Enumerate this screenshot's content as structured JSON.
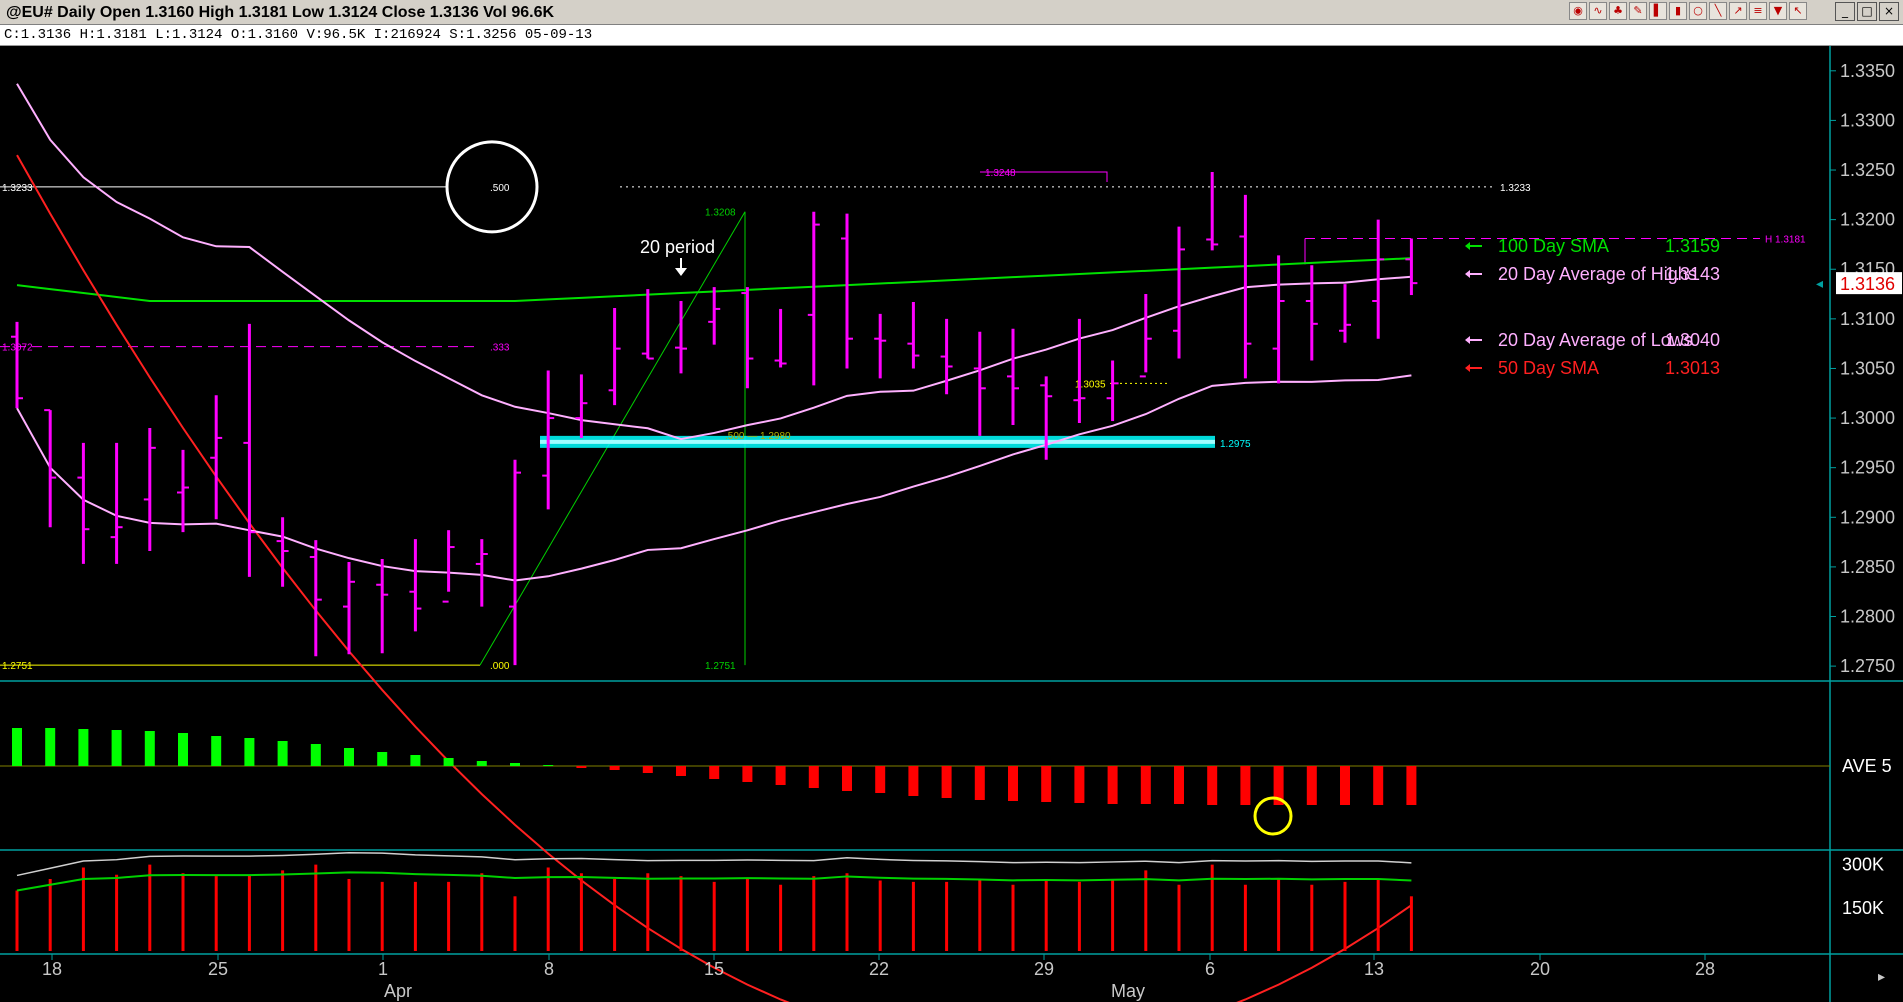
{
  "window": {
    "title": "@EU# Daily Open 1.3160 High 1.3181 Low 1.3124 Close 1.3136 Vol 96.6K",
    "info": "C:1.3136  H:1.3181  L:1.3124  O:1.3160  V:96.5K  I:216924  S:1.3256  05-09-13"
  },
  "toolbar_icons": [
    "globe-icon",
    "wave-icon",
    "tree-icon",
    "pencil-icon",
    "bars-icon",
    "candle-icon",
    "circle-icon",
    "line-icon",
    "arrow-icon",
    "fib-icon",
    "trash-icon",
    "cursor-icon"
  ],
  "window_controls": [
    "minimize-icon",
    "restore-icon",
    "close-icon"
  ],
  "colors": {
    "background": "#000000",
    "bars": "#ff00ff",
    "sma100": "#00e000",
    "sma50": "#ff2020",
    "avg_highs_lows": "#ffb0ff",
    "fib_channel": "#00ffff",
    "osc_positive": "#00ff00",
    "osc_negative": "#ff0000",
    "panel_border": "#00a0a0"
  },
  "chart_data": [
    {
      "type": "ohlc",
      "panel": "price",
      "y_axis": {
        "range": [
          1.2735,
          1.3375
        ],
        "ticks": [
          "1.3350",
          "1.3300",
          "1.3250",
          "1.3200",
          "1.3150",
          "1.3100",
          "1.3050",
          "1.3000",
          "1.2950",
          "1.2900",
          "1.2850",
          "1.2800",
          "1.2750"
        ]
      },
      "last_price_label": "1.3136",
      "bars": [
        {
          "o": 1.3082,
          "h": 1.3097,
          "l": 1.301,
          "c": 1.302
        },
        {
          "o": 1.3008,
          "h": 1.3008,
          "l": 1.289,
          "c": 1.294
        },
        {
          "o": 1.294,
          "h": 1.2975,
          "l": 1.2853,
          "c": 1.2888
        },
        {
          "o": 1.288,
          "h": 1.2975,
          "l": 1.2853,
          "c": 1.289
        },
        {
          "o": 1.2918,
          "h": 1.299,
          "l": 1.2866,
          "c": 1.297
        },
        {
          "o": 1.2925,
          "h": 1.2968,
          "l": 1.2885,
          "c": 1.293
        },
        {
          "o": 1.296,
          "h": 1.3023,
          "l": 1.2898,
          "c": 1.298
        },
        {
          "o": 1.2975,
          "h": 1.3095,
          "l": 1.284,
          "c": 1.2885
        },
        {
          "o": 1.2876,
          "h": 1.29,
          "l": 1.283,
          "c": 1.2866
        },
        {
          "o": 1.286,
          "h": 1.2877,
          "l": 1.276,
          "c": 1.2817
        },
        {
          "o": 1.281,
          "h": 1.2855,
          "l": 1.2762,
          "c": 1.2835
        },
        {
          "o": 1.2832,
          "h": 1.2858,
          "l": 1.2763,
          "c": 1.2822
        },
        {
          "o": 1.2825,
          "h": 1.2878,
          "l": 1.2785,
          "c": 1.2808
        },
        {
          "o": 1.2815,
          "h": 1.2887,
          "l": 1.2825,
          "c": 1.287
        },
        {
          "o": 1.2853,
          "h": 1.2878,
          "l": 1.281,
          "c": 1.2863
        },
        {
          "o": 1.281,
          "h": 1.2958,
          "l": 1.2751,
          "c": 1.2945
        },
        {
          "o": 1.2942,
          "h": 1.3048,
          "l": 1.2908,
          "c": 1.3
        },
        {
          "o": 1.3,
          "h": 1.3044,
          "l": 1.298,
          "c": 1.3015
        },
        {
          "o": 1.3028,
          "h": 1.3111,
          "l": 1.3013,
          "c": 1.307
        },
        {
          "o": 1.3065,
          "h": 1.313,
          "l": 1.306,
          "c": 1.306
        },
        {
          "o": 1.3071,
          "h": 1.3118,
          "l": 1.3045,
          "c": 1.307
        },
        {
          "o": 1.3097,
          "h": 1.3132,
          "l": 1.3074,
          "c": 1.311
        },
        {
          "o": 1.3126,
          "h": 1.3132,
          "l": 1.303,
          "c": 1.306
        },
        {
          "o": 1.3058,
          "h": 1.311,
          "l": 1.3051,
          "c": 1.3055
        },
        {
          "o": 1.3104,
          "h": 1.3208,
          "l": 1.3033,
          "c": 1.3195
        },
        {
          "o": 1.3181,
          "h": 1.3206,
          "l": 1.305,
          "c": 1.308
        },
        {
          "o": 1.308,
          "h": 1.3105,
          "l": 1.304,
          "c": 1.3078
        },
        {
          "o": 1.3075,
          "h": 1.3117,
          "l": 1.305,
          "c": 1.3063
        },
        {
          "o": 1.3062,
          "h": 1.31,
          "l": 1.3024,
          "c": 1.3052
        },
        {
          "o": 1.305,
          "h": 1.3087,
          "l": 1.2982,
          "c": 1.303
        },
        {
          "o": 1.3042,
          "h": 1.309,
          "l": 1.2993,
          "c": 1.303
        },
        {
          "o": 1.3033,
          "h": 1.3042,
          "l": 1.2958,
          "c": 1.3022
        },
        {
          "o": 1.3018,
          "h": 1.31,
          "l": 1.2995,
          "c": 1.302
        },
        {
          "o": 1.302,
          "h": 1.3058,
          "l": 1.2997,
          "c": 1.3035
        },
        {
          "o": 1.3042,
          "h": 1.3125,
          "l": 1.3046,
          "c": 1.308
        },
        {
          "o": 1.3088,
          "h": 1.3193,
          "l": 1.306,
          "c": 1.317
        },
        {
          "o": 1.318,
          "h": 1.3248,
          "l": 1.3169,
          "c": 1.3175
        },
        {
          "o": 1.3183,
          "h": 1.3225,
          "l": 1.304,
          "c": 1.3075
        },
        {
          "o": 1.307,
          "h": 1.3164,
          "l": 1.3035,
          "c": 1.3118
        },
        {
          "o": 1.3118,
          "h": 1.3154,
          "l": 1.3058,
          "c": 1.3095
        },
        {
          "o": 1.3088,
          "h": 1.3135,
          "l": 1.3076,
          "c": 1.3094
        },
        {
          "o": 1.3118,
          "h": 1.32,
          "l": 1.308,
          "c": 1.316
        },
        {
          "o": 1.316,
          "h": 1.3181,
          "l": 1.3124,
          "c": 1.3136
        }
      ],
      "moving_averages": [
        {
          "name": "100 Day SMA",
          "value": "1.3159",
          "color": "#00e000"
        },
        {
          "name": "20 Day Average of Highs",
          "value": "1.3143",
          "color": "#ffb0ff"
        },
        {
          "name": "20 Day Average of Lows",
          "value": "1.3040",
          "color": "#ffb0ff"
        },
        {
          "name": "50 Day SMA",
          "value": "1.3013",
          "color": "#ff2020"
        }
      ],
      "fib_annotations": {
        "left_low": "1.2751",
        "left_low_ratio": ".000",
        "left_high": "1.3233",
        "left_high_ratio": ".500",
        "left_mid": "1.3072",
        "left_mid_ratio": ".333",
        "right_high_line": "1.3233",
        "swing_high": "1.3208",
        "swing_low": "1.2751",
        "mid_ratio": ".500",
        "mid_value": "1.2980",
        "channel_right": "1.2975",
        "peak": "1.3248",
        "low_marker": "1.3035",
        "high_marker": "H 1.3181"
      },
      "annotation_text": "20 period",
      "x_axis": {
        "tick_labels": [
          "18",
          "25",
          "1",
          "8",
          "15",
          "22",
          "29",
          "6",
          "13",
          "20",
          "28"
        ],
        "month_labels": [
          "Apr",
          "May"
        ]
      }
    },
    {
      "type": "bar",
      "panel": "oscillator",
      "label": "AVE 5",
      "values": [
        38,
        38,
        37,
        36,
        35,
        33,
        30,
        28,
        25,
        22,
        18,
        14,
        11,
        8,
        5,
        3,
        1,
        -2,
        -4,
        -7,
        -10,
        -13,
        -16,
        -19,
        -22,
        -25,
        -27,
        -30,
        -32,
        -34,
        -35,
        -36,
        -37,
        -38,
        -38,
        -38,
        -39,
        -39,
        -39,
        -39,
        -39,
        -39,
        -39
      ]
    },
    {
      "type": "bar",
      "panel": "volume",
      "y_axis": {
        "ticks": [
          "300K",
          "150K"
        ]
      },
      "values": [
        210,
        250,
        290,
        265,
        300,
        270,
        260,
        265,
        280,
        300,
        250,
        240,
        240,
        240,
        270,
        190,
        290,
        270,
        250,
        270,
        260,
        240,
        250,
        230,
        260,
        270,
        245,
        240,
        240,
        250,
        230,
        250,
        240,
        250,
        280,
        230,
        300,
        230,
        250,
        230,
        240,
        250,
        190
      ]
    }
  ]
}
